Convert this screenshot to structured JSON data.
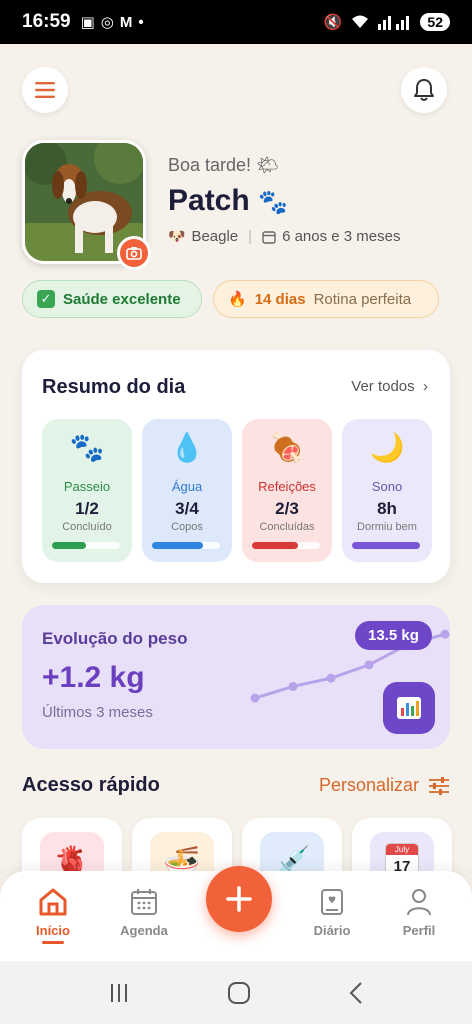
{
  "status_bar": {
    "time": "16:59",
    "battery": "52"
  },
  "pet": {
    "greeting": "Boa tarde!",
    "greeting_emoji": "🌤",
    "name": "Patch",
    "name_emoji": "🐾",
    "breed": "Beagle",
    "age": "6 anos e 3 meses"
  },
  "badges": {
    "health": "Saúde excelente",
    "streak_days": "14 dias",
    "streak_label": "Rotina perfeita"
  },
  "summary": {
    "title": "Resumo do dia",
    "see_all": "Ver todos",
    "tiles": [
      {
        "icon": "paw-icon",
        "glyph": "🐾",
        "label": "Passeio",
        "value": "1/2",
        "sub": "Concluído",
        "progress": 0.5,
        "color": "#2e9e50",
        "label_color": "#2e8a48"
      },
      {
        "icon": "water-drop-icon",
        "glyph": "💧",
        "label": "Água",
        "value": "3/4",
        "sub": "Copos",
        "progress": 0.75,
        "color": "#2f86e0",
        "label_color": "#2f7ad0"
      },
      {
        "icon": "meat-icon",
        "glyph": "🍖",
        "label": "Refeições",
        "value": "2/3",
        "sub": "Concluídas",
        "progress": 0.67,
        "color": "#d83a3a",
        "label_color": "#c33"
      },
      {
        "icon": "moon-icon",
        "glyph": "🌙",
        "label": "Sono",
        "value": "8h",
        "sub": "Dormiu bem",
        "progress": 1.0,
        "color": "#7a55d6",
        "label_color": "#6a55a6"
      }
    ]
  },
  "weight": {
    "title": "Evolução do peso",
    "value": "+1.2 kg",
    "period": "Últimos 3 meses",
    "current": "13.5 kg",
    "trend": [
      0.18,
      0.32,
      0.42,
      0.58,
      0.82,
      0.95
    ]
  },
  "quick_access": {
    "title": "Acesso rápido",
    "customize": "Personalizar",
    "items": [
      {
        "icon": "heart-organ-icon",
        "glyph": "🫀",
        "bg": "#fde3e6"
      },
      {
        "icon": "food-bowl-icon",
        "glyph": "🍜",
        "bg": "#fdf0dc"
      },
      {
        "icon": "syringe-icon",
        "glyph": "💉",
        "bg": "#e0ecfb"
      },
      {
        "icon": "calendar-icon",
        "glyph": "📅",
        "bg": "#ece6fa",
        "month": "July",
        "day": "17"
      }
    ]
  },
  "nav": {
    "home": "Início",
    "agenda": "Agenda",
    "diary": "Diário",
    "profile": "Perfil"
  },
  "colors": {
    "accent": "#f2623a",
    "purple": "#6e47c9",
    "background": "#f6f1ea"
  }
}
